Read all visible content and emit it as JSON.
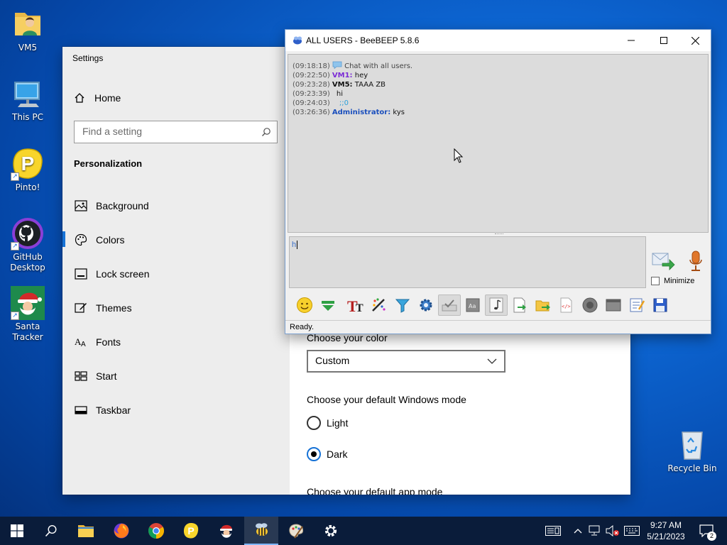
{
  "desktop": {
    "icons": [
      {
        "label": "VM5"
      },
      {
        "label": "This PC"
      },
      {
        "label": "Pinto!"
      },
      {
        "label": "GitHub Desktop"
      },
      {
        "label": "Santa Tracker"
      },
      {
        "label": "Recycle Bin"
      }
    ]
  },
  "settings": {
    "title": "Settings",
    "home": "Home",
    "search_placeholder": "Find a setting",
    "section": "Personalization",
    "nav": [
      "Background",
      "Colors",
      "Lock screen",
      "Themes",
      "Fonts",
      "Start",
      "Taskbar"
    ],
    "active_nav": "Colors",
    "content": {
      "choose_color_label": "Choose your color",
      "color_value": "Custom",
      "windows_mode_label": "Choose your default Windows mode",
      "light": "Light",
      "dark": "Dark",
      "selected_mode": "Dark",
      "app_mode_label": "Choose your default app mode"
    }
  },
  "beebeep": {
    "title": "ALL USERS - BeeBEEP 5.8.6",
    "messages": [
      {
        "time": "(09:18:18)",
        "user": "",
        "text": "Chat with all users."
      },
      {
        "time": "(09:22:50)",
        "user": "VM1:",
        "text": " hey"
      },
      {
        "time": "(09:23:28)",
        "user": "VM5:",
        "text": " TAAA ZB"
      },
      {
        "time": "(09:23:39)",
        "user": "",
        "text": "hi"
      },
      {
        "time": "(09:24:03)",
        "user": "",
        "text": ";;0"
      },
      {
        "time": "(03:26:36)",
        "user": "Administrator:",
        "text": " kys"
      }
    ],
    "input_value": "h",
    "minimize_label": "Minimize",
    "status": "Ready."
  },
  "taskbar": {
    "time": "9:27 AM",
    "date": "5/21/2023",
    "notification_count": "2"
  },
  "colors": {
    "accent": "#1672d6",
    "taskbar": "#0a1c3a",
    "vm1_user": "#7b2bd6",
    "admin_user": "#1b4fbd"
  }
}
